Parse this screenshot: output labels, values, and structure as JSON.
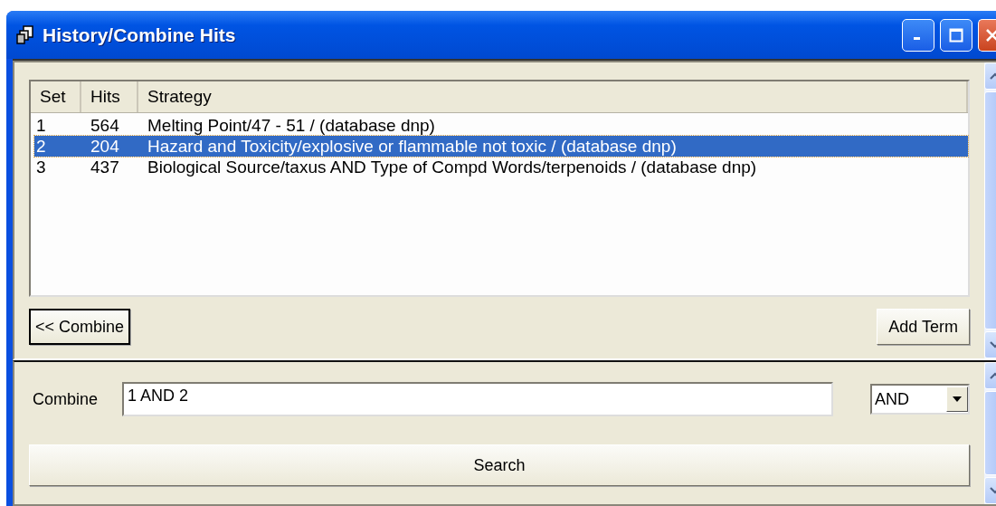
{
  "window": {
    "title": "History/Combine Hits"
  },
  "history": {
    "columns": [
      "Set",
      "Hits",
      "Strategy"
    ],
    "rows": [
      {
        "set": "1",
        "hits": "564",
        "strategy": "Melting Point/47 - 51 / (database dnp)",
        "selected": false
      },
      {
        "set": "2",
        "hits": "204",
        "strategy": "Hazard and Toxicity/explosive or flammable not toxic / (database dnp)",
        "selected": true
      },
      {
        "set": "3",
        "hits": "437",
        "strategy": "Biological Source/taxus AND Type of Compd Words/terpenoids / (database dnp)",
        "selected": false
      }
    ]
  },
  "buttons": [
    {
      "label": "<< Combine",
      "default": true
    },
    {
      "label": "Add Term",
      "default": false
    }
  ],
  "combine": {
    "label": "Combine",
    "value": "1 AND 2",
    "operator": "AND"
  },
  "search_button": "Search"
}
